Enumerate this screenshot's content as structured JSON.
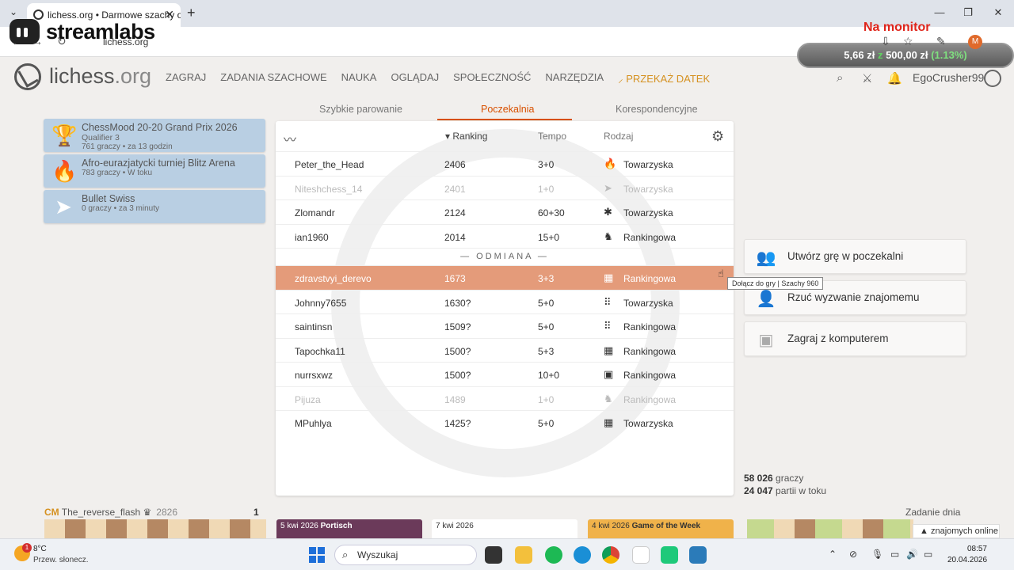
{
  "browser": {
    "tab_title": "lichess.org • Darmowe szachy o",
    "url": "lichess.org",
    "streamlabs_text": "streamlabs",
    "overlay_title": "Na monitor",
    "donation": {
      "current": "5,66 zł",
      "sep": "z",
      "goal": "500,00 zł",
      "percent": "(1.13%)"
    },
    "profile_initial": "M"
  },
  "header": {
    "logo": "lichess",
    "logo_suffix": ".org",
    "nav": [
      "ZAGRAJ",
      "ZADANIA SZACHOWE",
      "NAUKA",
      "OGLĄDAJ",
      "SPOŁECZNOŚĆ",
      "NARZĘDZIA"
    ],
    "donate": "PRZEKAŻ DATEK",
    "username": "EgoCrusher99"
  },
  "tournaments": [
    {
      "name": "ChessMood 20-20 Grand Prix 2026",
      "sub": "Qualifier 3",
      "players": "761 graczy",
      "when": "za 13 godzin",
      "icon": "trophy-icon"
    },
    {
      "name": "Afro-eurazjatycki turniej Blitz Arena",
      "sub": "",
      "players": "783 graczy",
      "when": "W toku",
      "icon": "flame-icon"
    },
    {
      "name": "Bullet Swiss",
      "sub": "",
      "players": "0 graczy",
      "when": "za 3 minuty",
      "icon": "bullet-icon"
    }
  ],
  "lobby_tabs": [
    "Szybkie parowanie",
    "Poczekalnia",
    "Korespondencyjne"
  ],
  "seek_table": {
    "headers": {
      "rating": "Ranking",
      "time": "Tempo",
      "mode": "Rodzaj"
    },
    "variant_separator": "— ODMIANA —",
    "rows": [
      {
        "name": "Peter_the_Head",
        "rating": "2406",
        "time": "3+0",
        "mode": "Towarzyska",
        "icon": "blitz-icon",
        "glyph": "🔥"
      },
      {
        "name": "Niteshchess_14",
        "rating": "2401",
        "time": "1+0",
        "mode": "Towarzyska",
        "icon": "bullet-icon",
        "glyph": "➤"
      },
      {
        "name": "Zlomandr",
        "rating": "2124",
        "time": "60+30",
        "mode": "Towarzyska",
        "icon": "classical-icon",
        "glyph": "✱"
      },
      {
        "name": "ian1960",
        "rating": "2014",
        "time": "15+0",
        "mode": "Rankingowa",
        "icon": "rapid-icon",
        "glyph": "♞"
      }
    ],
    "variant_rows": [
      {
        "name": "zdravstvyi_derevo",
        "rating": "1673",
        "time": "3+3",
        "mode": "Rankingowa",
        "icon": "chess960-icon",
        "glyph": "▦"
      },
      {
        "name": "Johnny7655",
        "rating": "1630?",
        "time": "5+0",
        "mode": "Towarzyska",
        "icon": "crazyhouse-icon",
        "glyph": "⠿"
      },
      {
        "name": "saintinsn",
        "rating": "1509?",
        "time": "5+0",
        "mode": "Rankingowa",
        "icon": "crazyhouse-icon",
        "glyph": "⠿"
      },
      {
        "name": "Tapochka11",
        "rating": "1500?",
        "time": "5+3",
        "mode": "Rankingowa",
        "icon": "chess960-icon",
        "glyph": "▦"
      },
      {
        "name": "nurrsxwz",
        "rating": "1500?",
        "time": "10+0",
        "mode": "Rankingowa",
        "icon": "horde-icon",
        "glyph": "▣"
      },
      {
        "name": "Pijuza",
        "rating": "1489",
        "time": "1+0",
        "mode": "Rankingowa",
        "icon": "variant-icon",
        "glyph": "♞"
      },
      {
        "name": "MPuhlya",
        "rating": "1425?",
        "time": "5+0",
        "mode": "Towarzyska",
        "icon": "chess960-icon",
        "glyph": "▦"
      }
    ],
    "tooltip": "Dołącz do gry | Szachy 960"
  },
  "actions": [
    {
      "label": "Utwórz grę w poczekalni",
      "icon": "users-icon"
    },
    {
      "label": "Rzuć wyzwanie znajomemu",
      "icon": "friend-icon"
    },
    {
      "label": "Zagraj z komputerem",
      "icon": "cpu-icon"
    }
  ],
  "stats": {
    "players_num": "58 026",
    "players_label": "graczy",
    "games_num": "24 047",
    "games_label": "partii w toku"
  },
  "bottom": {
    "tv_title": "CM",
    "tv_player": "The_reverse_flash",
    "tv_rating": "2826",
    "tv_count": "1",
    "blogs": [
      {
        "date": "5 kwi 2026",
        "title": "Portisch"
      },
      {
        "date": "7 kwi 2026",
        "title": ""
      },
      {
        "date": "4 kwi 2026",
        "title": "Game of the Week"
      }
    ],
    "daily_puzzle": "Zadanie dnia",
    "friends": "znajomych online"
  },
  "taskbar": {
    "badge": "1",
    "temp": "8°C",
    "weather": "Przew. słonecz.",
    "search": "Wyszukaj",
    "time": "08:57",
    "date": "20.04.2026"
  },
  "colors": {
    "accent": "#d85000",
    "highlight_row": "#e49b7a",
    "tourney_bg": "#b9cfe3",
    "donate": "#d59120",
    "overlay_red": "#e0251b"
  }
}
